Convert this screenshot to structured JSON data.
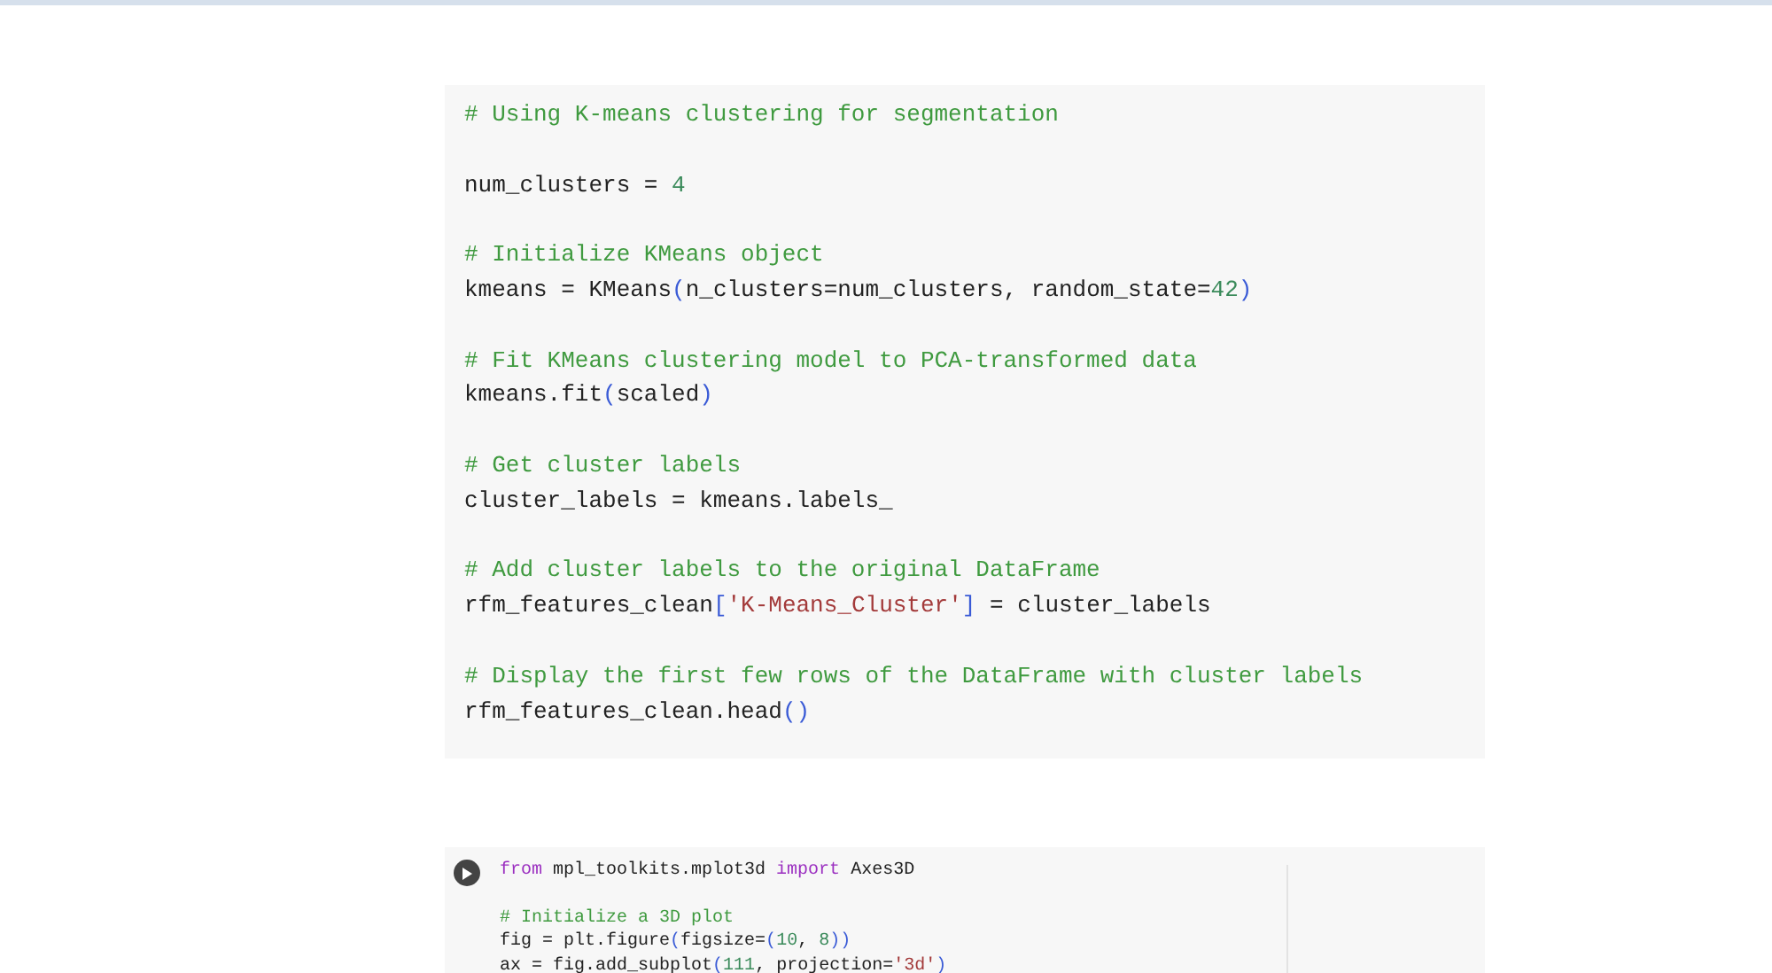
{
  "cells": [
    {
      "kind": "markdown_code",
      "lines": [
        {
          "tokens": [
            {
              "text": "# Using K-means clustering for segmentation",
              "kind": "comment"
            }
          ]
        },
        {
          "blank_before": true,
          "tokens": [
            {
              "text": "num_clusters = ",
              "kind": "plain"
            },
            {
              "text": "4",
              "kind": "number"
            }
          ]
        },
        {
          "blank_before": true,
          "tokens": [
            {
              "text": "# Initialize KMeans object",
              "kind": "comment"
            }
          ]
        },
        {
          "tokens": [
            {
              "text": "kmeans = KMeans",
              "kind": "plain"
            },
            {
              "text": "(",
              "kind": "bracket"
            },
            {
              "text": "n_clusters=num_clusters, random_state=",
              "kind": "plain"
            },
            {
              "text": "42",
              "kind": "number"
            },
            {
              "text": ")",
              "kind": "bracket"
            }
          ]
        },
        {
          "blank_before": true,
          "tokens": [
            {
              "text": "# Fit KMeans clustering model to PCA-transformed data",
              "kind": "comment"
            }
          ]
        },
        {
          "tokens": [
            {
              "text": "kmeans.fit",
              "kind": "plain"
            },
            {
              "text": "(",
              "kind": "bracket"
            },
            {
              "text": "scaled",
              "kind": "plain"
            },
            {
              "text": ")",
              "kind": "bracket"
            }
          ]
        },
        {
          "blank_before": true,
          "tokens": [
            {
              "text": "# Get cluster labels",
              "kind": "comment"
            }
          ]
        },
        {
          "tokens": [
            {
              "text": "cluster_labels = kmeans.labels_",
              "kind": "plain"
            }
          ]
        },
        {
          "blank_before": true,
          "tokens": [
            {
              "text": "# Add cluster labels to the original DataFrame",
              "kind": "comment"
            }
          ]
        },
        {
          "tokens": [
            {
              "text": "rfm_features_clean",
              "kind": "plain"
            },
            {
              "text": "[",
              "kind": "bracket"
            },
            {
              "text": "'K-Means_Cluster'",
              "kind": "string"
            },
            {
              "text": "]",
              "kind": "bracket"
            },
            {
              "text": " = cluster_labels",
              "kind": "plain"
            }
          ]
        },
        {
          "blank_before": true,
          "tokens": [
            {
              "text": "# Display the first few rows of the DataFrame with cluster labels",
              "kind": "comment"
            }
          ]
        },
        {
          "tokens": [
            {
              "text": "rfm_features_clean.head",
              "kind": "plain"
            },
            {
              "text": "()",
              "kind": "bracket"
            }
          ]
        }
      ]
    },
    {
      "kind": "runnable",
      "lines": [
        {
          "tokens": [
            {
              "text": "from",
              "kind": "keyword"
            },
            {
              "text": " mpl_toolkits.mplot3d ",
              "kind": "plain"
            },
            {
              "text": "import",
              "kind": "keyword"
            },
            {
              "text": " Axes3D",
              "kind": "plain"
            }
          ]
        },
        {
          "blank_before": true,
          "tokens": [
            {
              "text": "# Initialize a 3D plot",
              "kind": "comment"
            }
          ]
        },
        {
          "tokens": [
            {
              "text": "fig = plt.figure",
              "kind": "plain"
            },
            {
              "text": "(",
              "kind": "bracket"
            },
            {
              "text": "figsize=",
              "kind": "plain"
            },
            {
              "text": "(",
              "kind": "bracket"
            },
            {
              "text": "10",
              "kind": "number"
            },
            {
              "text": ", ",
              "kind": "plain"
            },
            {
              "text": "8",
              "kind": "number"
            },
            {
              "text": "))",
              "kind": "bracket"
            }
          ]
        },
        {
          "tokens": [
            {
              "text": "ax = fig.add_subplot",
              "kind": "plain"
            },
            {
              "text": "(",
              "kind": "bracket"
            },
            {
              "text": "111",
              "kind": "number"
            },
            {
              "text": ", projection=",
              "kind": "plain"
            },
            {
              "text": "'3d'",
              "kind": "string"
            },
            {
              "text": ")",
              "kind": "bracket"
            }
          ]
        }
      ]
    }
  ]
}
